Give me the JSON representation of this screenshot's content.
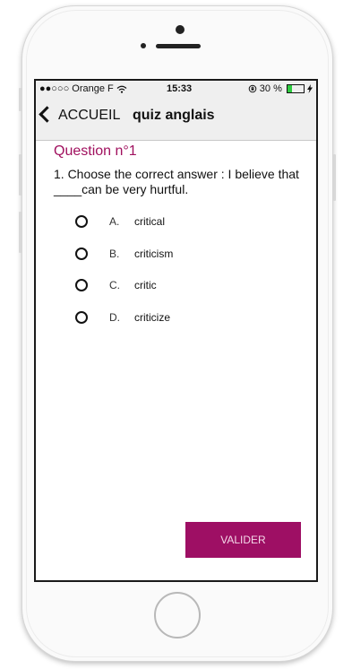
{
  "status_bar": {
    "signal": "●●○○○",
    "carrier": "Orange F",
    "wifi_icon": "wifi-icon",
    "time": "15:33",
    "rotation_lock_icon": "rotation-lock-icon",
    "battery_text": "30 %",
    "battery_level": 0.3,
    "charging_icon": "bolt-icon"
  },
  "nav": {
    "back_label": "ACCUEIL",
    "title": "quiz anglais"
  },
  "question": {
    "header": "Question n°1",
    "text": "1. Choose the correct answer : I believe that ____can be very hurtful.",
    "options": [
      {
        "letter": "A.",
        "text": "critical"
      },
      {
        "letter": "B.",
        "text": "criticism"
      },
      {
        "letter": "C.",
        "text": "critic"
      },
      {
        "letter": "D.",
        "text": "criticize"
      }
    ]
  },
  "actions": {
    "submit_label": "VALIDER"
  },
  "colors": {
    "accent": "#9e0f64",
    "question_header": "#a0105e",
    "navbar_bg": "#efefef"
  }
}
